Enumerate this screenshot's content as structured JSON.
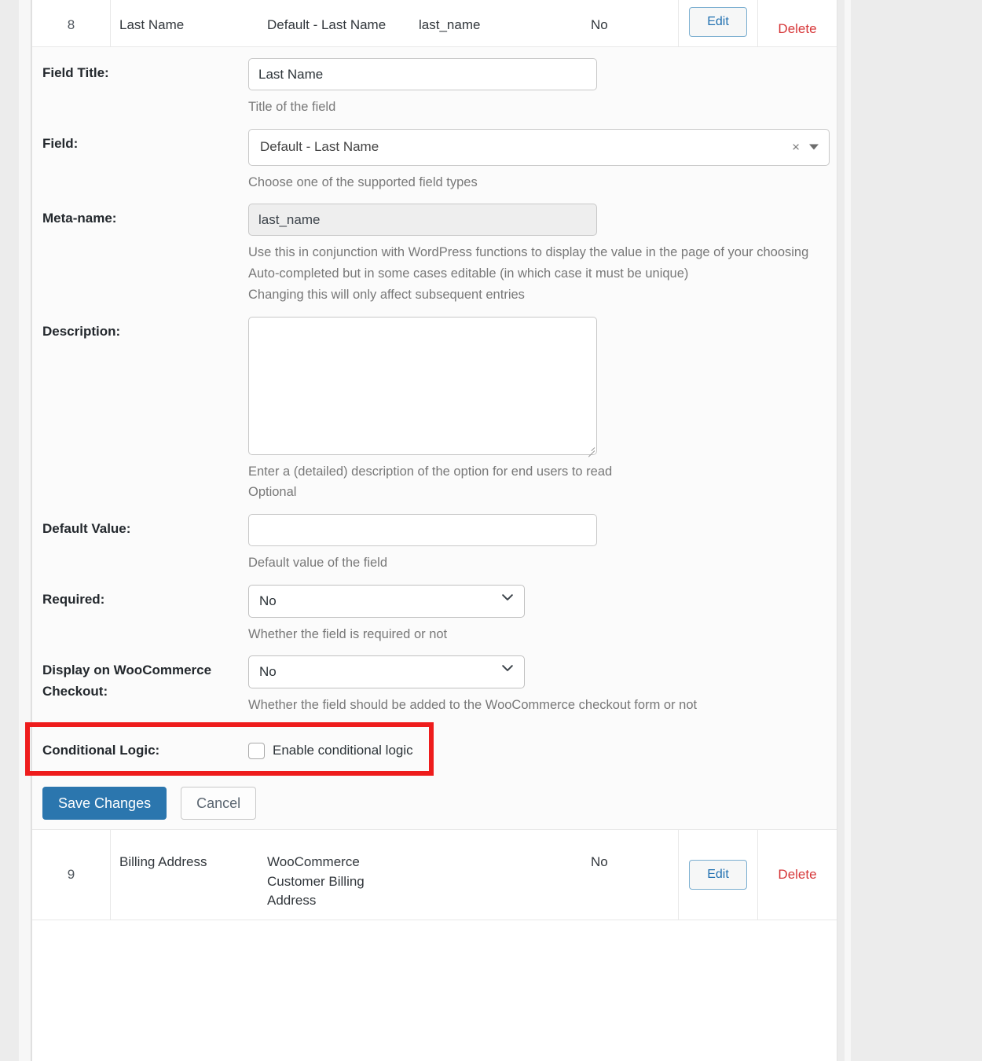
{
  "table": {
    "rows": [
      {
        "id": "8",
        "title": "Last Name",
        "field": "Default - Last Name",
        "meta": "last_name",
        "required": "No",
        "edit_label": "Edit",
        "delete_label": "Delete"
      },
      {
        "id": "9",
        "title": "Billing Address",
        "field": "WooCommerce Customer Billing Address",
        "meta": "",
        "required": "No",
        "edit_label": "Edit",
        "delete_label": "Delete"
      }
    ]
  },
  "form": {
    "field_title": {
      "label": "Field Title:",
      "value": "Last Name",
      "hint": "Title of the field"
    },
    "field": {
      "label": "Field:",
      "value": "Default - Last Name",
      "hint": "Choose one of the supported field types",
      "clear_icon": "×"
    },
    "meta_name": {
      "label": "Meta-name:",
      "value": "last_name",
      "hint_1": "Use this in conjunction with WordPress functions to display the value in the page of your choosing",
      "hint_2": "Auto-completed but in some cases editable (in which case it must be unique)",
      "hint_3": "Changing this will only affect subsequent entries"
    },
    "description": {
      "label": "Description:",
      "value": "",
      "hint_1": "Enter a (detailed) description of the option for end users to read",
      "hint_2": "Optional"
    },
    "default_value": {
      "label": "Default Value:",
      "value": "",
      "hint": "Default value of the field"
    },
    "required": {
      "label": "Required:",
      "value": "No",
      "hint": "Whether the field is required or not"
    },
    "woocommerce_checkout": {
      "label": "Display on WooCommerce Checkout:",
      "value": "No",
      "hint": "Whether the field should be added to the WooCommerce checkout form or not"
    },
    "conditional_logic": {
      "label": "Conditional Logic:",
      "checkbox_label": "Enable conditional logic",
      "checked": false
    },
    "save_label": "Save Changes",
    "cancel_label": "Cancel"
  },
  "colors": {
    "primary": "#2b76ae",
    "link": "#2271b1",
    "danger": "#d63638",
    "annotation": "#ee1c1c"
  }
}
